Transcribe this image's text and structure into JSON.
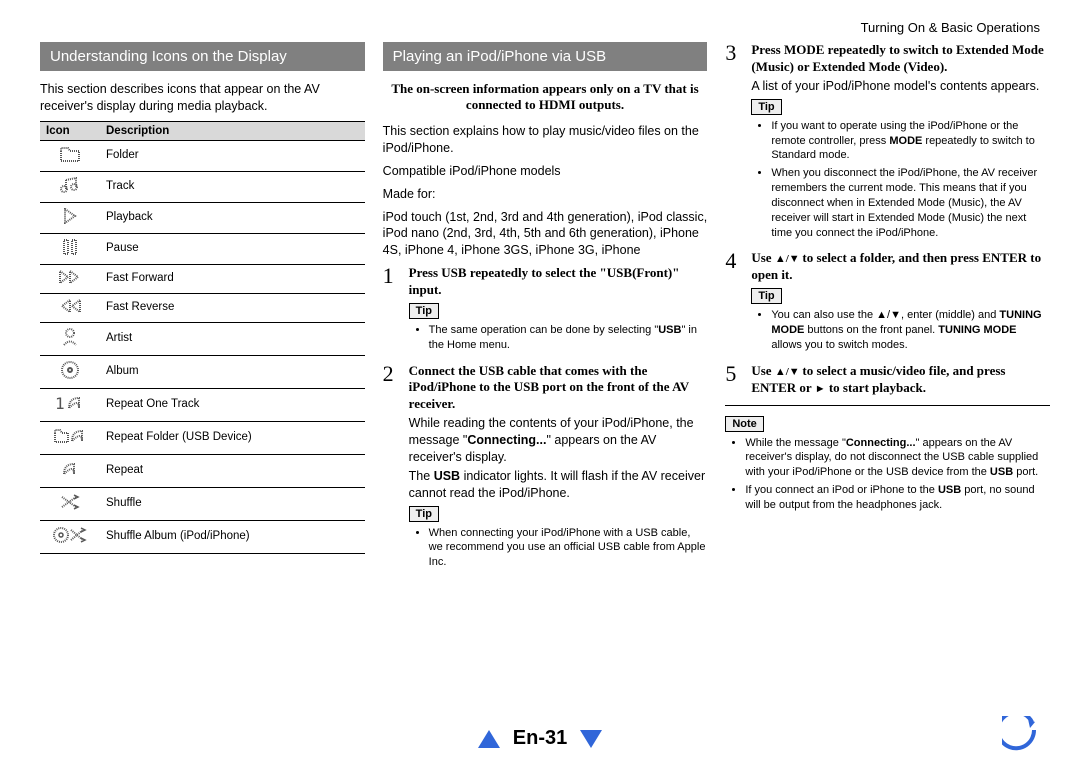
{
  "header": {
    "section": "Turning On & Basic Operations"
  },
  "col1": {
    "title": "Understanding Icons on the Display",
    "intro": "This section describes icons that appear on the AV receiver's display during media playback.",
    "table_headers": {
      "icon": "Icon",
      "desc": "Description"
    },
    "rows": [
      {
        "d": "Folder"
      },
      {
        "d": "Track"
      },
      {
        "d": "Playback"
      },
      {
        "d": "Pause"
      },
      {
        "d": "Fast Forward"
      },
      {
        "d": "Fast Reverse"
      },
      {
        "d": "Artist"
      },
      {
        "d": "Album"
      },
      {
        "d": "Repeat One Track"
      },
      {
        "d": "Repeat Folder (USB Device)"
      },
      {
        "d": "Repeat"
      },
      {
        "d": "Shuffle"
      },
      {
        "d": "Shuffle Album (iPod/iPhone)"
      }
    ]
  },
  "col2": {
    "title": "Playing an iPod/iPhone via USB",
    "notice": "The on-screen information appears only on a TV that is connected to HDMI outputs.",
    "intro": "This section explains how to play music/video files on the iPod/iPhone.",
    "compat_label": "Compatible iPod/iPhone models",
    "made_for": "Made for:",
    "models": "iPod touch (1st, 2nd, 3rd and 4th generation), iPod classic, iPod nano (2nd, 3rd, 4th, 5th and 6th generation), iPhone 4S, iPhone 4, iPhone 3GS, iPhone 3G, iPhone",
    "step1": {
      "num": "1",
      "title_a": "Press ",
      "title_b": "USB",
      "title_c": " repeatedly to select the \"USB(Front)\" input.",
      "tip_label": "Tip",
      "tip1_a": "The same operation can be done by selecting \"",
      "tip1_b": "USB",
      "tip1_c": "\" in the Home menu."
    },
    "step2": {
      "num": "2",
      "title_a": "Connect the USB cable that comes with the iPod/iPhone to the ",
      "title_b": "USB",
      "title_c": " port on the front of the AV receiver.",
      "p1_a": "While reading the contents of your iPod/iPhone, the message \"",
      "p1_b": "Connecting...",
      "p1_c": "\" appears on the AV receiver's display.",
      "p2_a": "The ",
      "p2_b": "USB",
      "p2_c": " indicator lights. It will flash if the AV receiver cannot read the iPod/iPhone.",
      "tip_label": "Tip",
      "tip1": "When connecting your iPod/iPhone with a USB cable, we recommend you use an official USB cable from Apple Inc."
    }
  },
  "col3": {
    "step3": {
      "num": "3",
      "title_a": "Press ",
      "title_b": "MODE",
      "title_c": " repeatedly to switch to Extended Mode (Music) or Extended Mode (Video).",
      "p1": "A list of your iPod/iPhone model's contents appears.",
      "tip_label": "Tip",
      "tip1_a": "If you want to operate using the iPod/iPhone or the remote controller, press ",
      "tip1_b": "MODE",
      "tip1_c": " repeatedly to switch to Standard mode.",
      "tip2": "When you disconnect the iPod/iPhone, the AV receiver remembers the current mode. This means that if you disconnect when in Extended Mode (Music), the AV receiver will start in Extended Mode (Music) the next time you connect the iPod/iPhone."
    },
    "step4": {
      "num": "4",
      "title_a": "Use ",
      "title_arrows": "▲/▼ ",
      "title_b": "to select a folder, and then press ",
      "title_c": "ENTER",
      "title_d": " to open it.",
      "tip_label": "Tip",
      "tip1_a": "You can also use the ",
      "tip1_arrows": "▲/▼",
      "tip1_b": ", enter (middle) and ",
      "tip1_c": "TUNING MODE",
      "tip1_d": " buttons on the front panel. ",
      "tip1_e": "TUNING MODE",
      "tip1_f": " allows you to switch modes."
    },
    "step5": {
      "num": "5",
      "title_a": "Use ",
      "title_arrows": "▲/▼ ",
      "title_b": "to select a music/video file, and press ",
      "title_c": "ENTER",
      "title_d": " or ",
      "title_play": "►",
      "title_e": " to start playback."
    },
    "note_label": "Note",
    "note1_a": "While the message \"",
    "note1_b": "Connecting...",
    "note1_c": "\" appears on the AV receiver's display, do not disconnect the USB cable supplied with your iPod/iPhone or the USB device from the ",
    "note1_d": "USB",
    "note1_e": " port.",
    "note2_a": "If you connect an iPod or iPhone to the ",
    "note2_b": "USB",
    "note2_c": " port, no sound will be output from the headphones jack."
  },
  "footer": {
    "page": "En-31"
  }
}
